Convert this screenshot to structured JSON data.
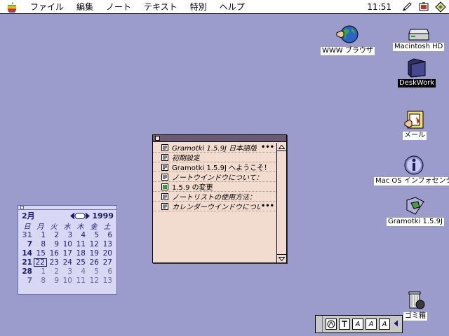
{
  "menubar": {
    "apple_icon": "apple-icon",
    "menus": [
      "ファイル",
      "編集",
      "ノート",
      "テキスト",
      "特別",
      "ヘルプ"
    ],
    "clock": "11:51",
    "right_icons": [
      "pencil-icon",
      "app-menu-icon",
      "application-switcher-icon"
    ]
  },
  "desktop": {
    "icons": [
      {
        "label": "WWW ブラウザ",
        "icon": "globe-icon"
      },
      {
        "label": "Macintosh HD",
        "icon": "hard-disk-icon"
      },
      {
        "label": "DeskWork",
        "icon": "folder-icon"
      },
      {
        "label": "メール",
        "icon": "mail-icon"
      },
      {
        "label": "Mac OS インフォセンタ",
        "icon": "info-icon"
      },
      {
        "label": "Gramotki 1.5.9J",
        "icon": "gramotki-folder-icon"
      },
      {
        "label": "ゴミ箱",
        "icon": "trash-icon"
      }
    ]
  },
  "note_window": {
    "items": [
      {
        "title": "Gramotki 1.5.9J 日本語版",
        "more": "•••",
        "icon": "note-icon"
      },
      {
        "title": "初期設定",
        "more": "",
        "icon": "note-icon"
      },
      {
        "title": "Gramotki 1.5.9J へようこそ！",
        "more": "",
        "icon": "note-icon"
      },
      {
        "title": "ノートウインドウについて：",
        "more": "",
        "icon": "note-icon"
      },
      {
        "title": "1.5.9 の変更",
        "more": "",
        "icon": "note-icon"
      },
      {
        "title": "ノートリストの使用方法：",
        "more": "",
        "icon": "note-icon"
      },
      {
        "title": "カレンダーウインドウについ",
        "more": "•••",
        "icon": "note-icon"
      }
    ]
  },
  "calendar": {
    "month": "2月",
    "year": "1999",
    "weekdays": [
      "日",
      "月",
      "火",
      "水",
      "木",
      "金",
      "土"
    ],
    "weeks": [
      [
        "31",
        "1",
        "2",
        "3",
        "4",
        "5",
        "6"
      ],
      [
        "7",
        "8",
        "9",
        "10",
        "11",
        "12",
        "13"
      ],
      [
        "14",
        "15",
        "16",
        "17",
        "18",
        "19",
        "20"
      ],
      [
        "21",
        "22",
        "23",
        "24",
        "25",
        "26",
        "27"
      ],
      [
        "28",
        "1",
        "2",
        "3",
        "4",
        "5",
        "6"
      ],
      [
        "7",
        "8",
        "9",
        "10",
        "11",
        "12",
        "13"
      ]
    ]
  },
  "control_strip": {
    "buttons": [
      "keyboard-icon",
      "text-style-icon",
      "font-a-icon",
      "italic-a-icon",
      "size-a-icon"
    ],
    "labels": [
      "",
      "",
      "A",
      "A",
      "A"
    ]
  },
  "colors": {
    "desktop": "#9c9ccc",
    "note_bg": "#f2dcd0",
    "calendar_bg": "#d8d8f4",
    "calendar_text": "#1a1a70"
  }
}
